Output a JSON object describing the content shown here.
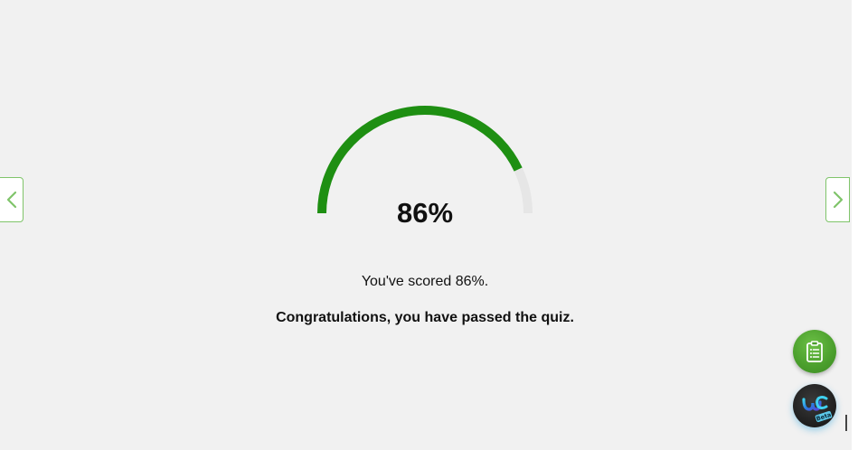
{
  "result": {
    "percent": 86,
    "score_display": "86%",
    "score_message": "You've scored 86%.",
    "pass_message": "Congratulations, you have passed the quiz."
  },
  "gauge": {
    "fill_fraction": 0.86,
    "fill_color": "#1e8f12",
    "track_color": "#e6e6e6"
  },
  "navigation": {
    "prev_icon": "chevron-left-icon",
    "next_icon": "chevron-right-icon",
    "accent_color": "#7fc46a"
  },
  "floating_actions": {
    "clipboard_icon": "clipboard-list-icon",
    "assistant_icon": "assistant-logo-icon",
    "assistant_badge": "Beta"
  }
}
